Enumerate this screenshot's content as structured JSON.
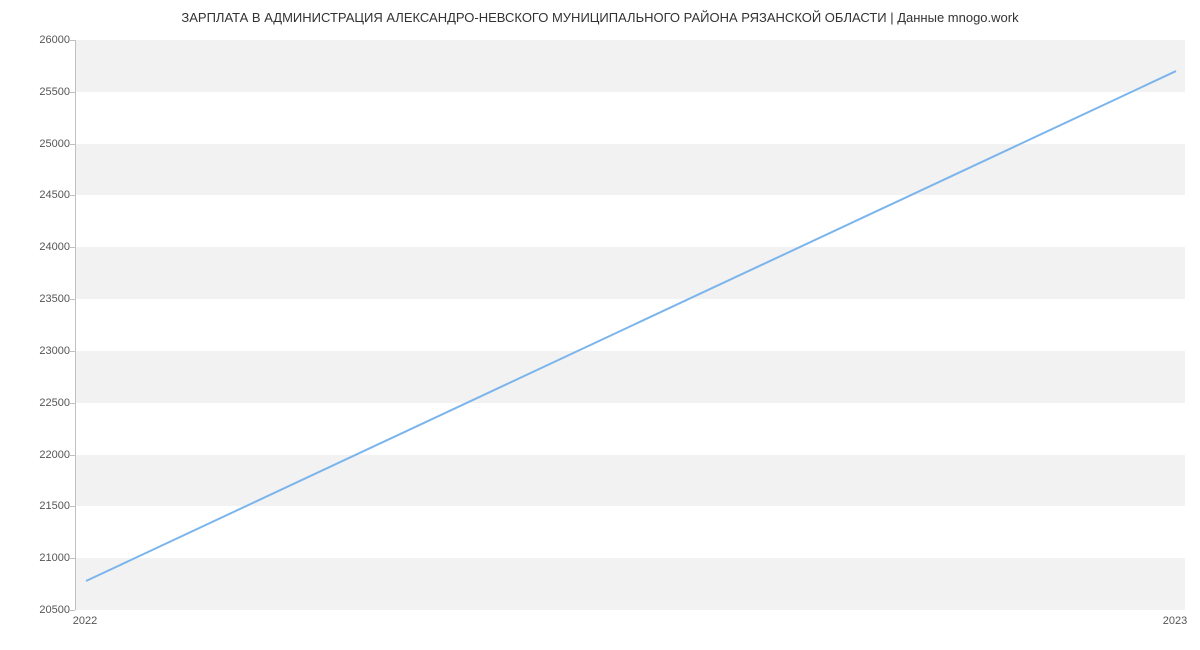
{
  "chart_data": {
    "type": "line",
    "title": "ЗАРПЛАТА В АДМИНИСТРАЦИЯ АЛЕКСАНДРО-НЕВСКОГО МУНИЦИПАЛЬНОГО РАЙОНА РЯЗАНСКОЙ ОБЛАСТИ | Данные mnogo.work",
    "xlabel": "",
    "ylabel": "",
    "x_categories": [
      "2022",
      "2023"
    ],
    "x_positions": [
      0,
      1
    ],
    "y_ticks": [
      20500,
      21000,
      21500,
      22000,
      22500,
      23000,
      23500,
      24000,
      24500,
      25000,
      25500,
      26000
    ],
    "ylim": [
      20500,
      26000
    ],
    "series": [
      {
        "name": "salary",
        "color": "#7cb5ec",
        "x": [
          0,
          1
        ],
        "y": [
          20780,
          25700
        ]
      }
    ]
  }
}
